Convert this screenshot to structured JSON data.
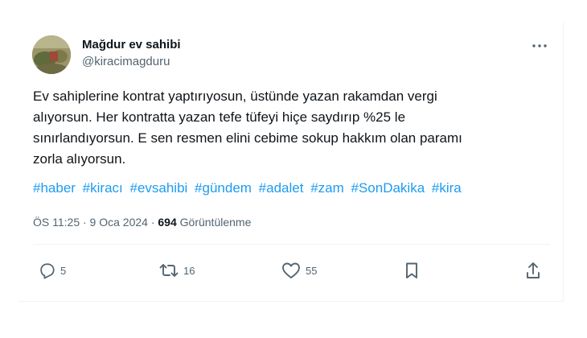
{
  "author": {
    "display_name": "Mağdur ev sahibi",
    "handle": "@kiracimagduru"
  },
  "tweet": {
    "lines": [
      "Ev sahiplerine kontrat yaptırıyosun, üstünde yazan rakamdan vergi",
      "alıyorsun. Her kontratta yazan tefe tüfeyi hiçe saydırıp %25 le",
      "sınırlandıyorsun. E sen resmen elini cebime sokup hakkım olan paramı",
      "zorla alıyorsun."
    ],
    "hashtags": [
      "#haber",
      "#kiracı",
      "#evsahibi",
      "#gündem",
      "#adalet",
      "#zam",
      "#SonDakika",
      "#kira"
    ]
  },
  "meta": {
    "time_date": "ÖS 11:25 · 9 Oca 2024 · ",
    "views_count": "694",
    "views_label": " Görüntülenme"
  },
  "actions": {
    "replies": "5",
    "retweets": "16",
    "likes": "55"
  },
  "colors": {
    "link": "#1d9bf0",
    "text": "#0f1419",
    "secondary": "#536471"
  },
  "icons": [
    "avatar-photo",
    "more-icon",
    "reply-icon",
    "retweet-icon",
    "like-icon",
    "bookmark-icon",
    "share-icon"
  ]
}
